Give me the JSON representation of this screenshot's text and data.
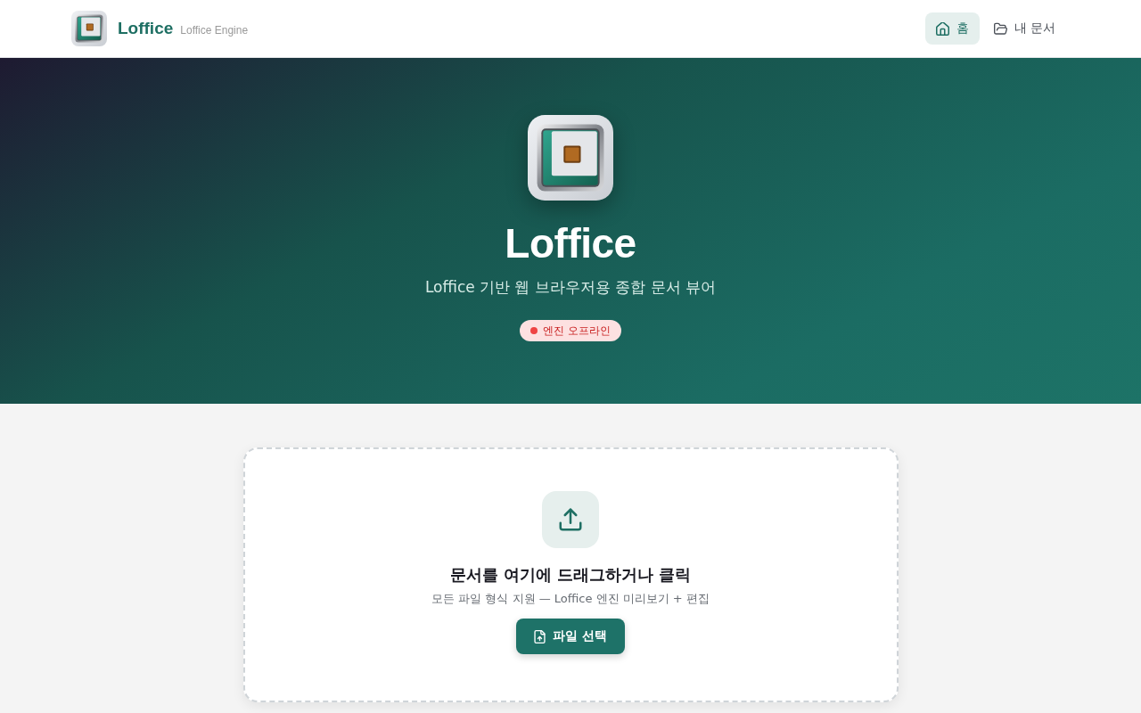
{
  "header": {
    "brand": "Loffice",
    "subtitle": "Loffice Engine",
    "nav": [
      {
        "label": "홈",
        "kind": "home",
        "selected": true
      },
      {
        "label": "내 문서",
        "kind": "folder",
        "selected": false
      }
    ]
  },
  "hero": {
    "title": "Loffice",
    "tagline": "Loffice 기반 웹 브라우저용 종합 문서 뷰어",
    "status": {
      "label": "엔진 오프라인",
      "online": false
    }
  },
  "upload": {
    "title": "문서를 여기에 드래그하거나 클릭",
    "hint": "모든 파일 형식 지원 — Loffice 엔진 미리보기 + 편집",
    "button": "파일 선택"
  }
}
